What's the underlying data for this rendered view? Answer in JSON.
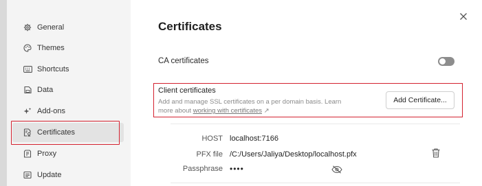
{
  "sidebar": {
    "items": [
      {
        "label": "General",
        "icon": "gear-icon"
      },
      {
        "label": "Themes",
        "icon": "palette-icon"
      },
      {
        "label": "Shortcuts",
        "icon": "keyboard-icon"
      },
      {
        "label": "Data",
        "icon": "data-icon"
      },
      {
        "label": "Add-ons",
        "icon": "sparkle-icon"
      },
      {
        "label": "Certificates",
        "icon": "certificate-icon",
        "active": true
      },
      {
        "label": "Proxy",
        "icon": "proxy-icon"
      },
      {
        "label": "Update",
        "icon": "update-icon"
      }
    ]
  },
  "main": {
    "title": "Certificates",
    "ca": {
      "label": "CA certificates",
      "enabled": false
    },
    "client": {
      "title": "Client certificates",
      "description": "Add and manage SSL certificates on a per domain basis. Learn more about",
      "link": "working with certificates",
      "link_arrow": "↗",
      "add_button": "Add Certificate..."
    },
    "certificate": {
      "host_label": "HOST",
      "host_value": "localhost:7166",
      "pfx_label": "PFX file",
      "pfx_value": "/C:/Users/Jaliya/Desktop/localhost.pfx",
      "passphrase_label": "Passphrase",
      "passphrase_value": "••••"
    }
  },
  "colors": {
    "highlight": "#d3202e",
    "toggle_off": "#8d8d8d"
  }
}
